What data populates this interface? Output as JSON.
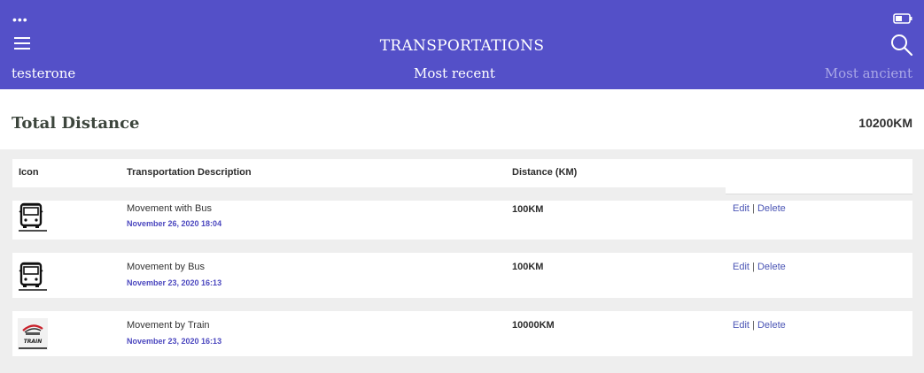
{
  "header": {
    "title": "TRANSPORTATIONS",
    "user": "testerone",
    "sort_recent": "Most recent",
    "sort_ancient": "Most ancient",
    "dots": "•••"
  },
  "summary": {
    "label": "Total Distance",
    "value": "10200KM"
  },
  "table": {
    "columns": [
      "Icon",
      "Transportation Description",
      "Distance (KM)"
    ],
    "rows": [
      {
        "icon": "bus-icon",
        "description": "Movement with Bus",
        "date": "November 26, 2020 18:04",
        "distance": "100KM",
        "edit": "Edit",
        "sep": "|",
        "delete": "Delete"
      },
      {
        "icon": "bus-icon",
        "description": "Movement by Bus",
        "date": "November 23, 2020 16:13",
        "distance": "100KM",
        "edit": "Edit",
        "sep": "|",
        "delete": "Delete"
      },
      {
        "icon": "train-icon",
        "description": "Movement by Train",
        "date": "November 23, 2020 16:13",
        "distance": "10000KM",
        "edit": "Edit",
        "sep": "|",
        "delete": "Delete",
        "icon_text": "TRAIN"
      }
    ]
  },
  "colors": {
    "header_bg": "#5450c8",
    "date_text": "#4b47bf",
    "link": "#4b55b5"
  }
}
